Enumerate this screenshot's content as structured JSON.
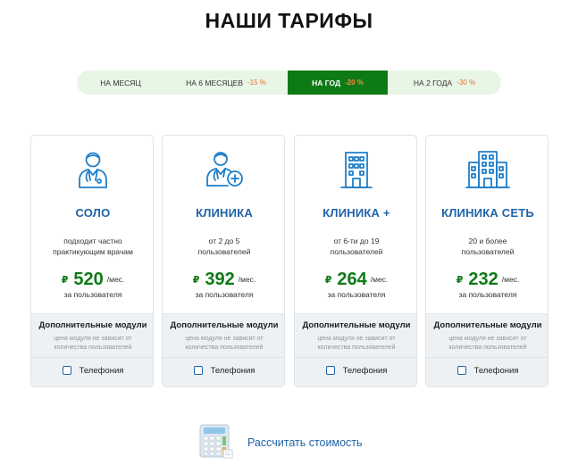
{
  "page": {
    "title": "НАШИ ТАРИФЫ"
  },
  "periods": [
    {
      "label": "НА МЕСЯЦ",
      "discount": "",
      "active": false
    },
    {
      "label": "НА 6 МЕСЯЦЕВ",
      "discount": "-15 %",
      "active": false
    },
    {
      "label": "НА ГОД",
      "discount": "-20 %",
      "active": true
    },
    {
      "label": "НА 2 ГОДА",
      "discount": "-30 %",
      "active": false
    }
  ],
  "plans": [
    {
      "icon": "doctor-icon",
      "name": "СОЛО",
      "desc_line1": "подходит частно",
      "desc_line2": "практикующим врачам",
      "currency": "₽",
      "price": "520",
      "unit": "/мес.",
      "per": "за пользователя",
      "modules_title": "Дополнительные модули",
      "modules_note_line1": "цена модуля не зависит от",
      "modules_note_line2": "количества пользователей",
      "option": "Телефония",
      "option_checked": false
    },
    {
      "icon": "doctor-plus-icon",
      "name": "КЛИНИКА",
      "desc_line1": "от 2 до 5",
      "desc_line2": "пользователей",
      "currency": "₽",
      "price": "392",
      "unit": "/мес.",
      "per": "за пользователя",
      "modules_title": "Дополнительные модули",
      "modules_note_line1": "цена модуля не зависит от",
      "modules_note_line2": "количества пользователей",
      "option": "Телефония",
      "option_checked": false
    },
    {
      "icon": "building-icon",
      "name": "КЛИНИКА +",
      "desc_line1": "от 6-ти до 19",
      "desc_line2": "пользователей",
      "currency": "₽",
      "price": "264",
      "unit": "/мес.",
      "per": "за пользователя",
      "modules_title": "Дополнительные модули",
      "modules_note_line1": "цена модуля не зависит от",
      "modules_note_line2": "количества пользователей",
      "option": "Телефония",
      "option_checked": false
    },
    {
      "icon": "hospital-network-icon",
      "name": "КЛИНИКА СЕТЬ",
      "desc_line1": "20 и более",
      "desc_line2": "пользователей",
      "currency": "₽",
      "price": "232",
      "unit": "/мес.",
      "per": "за пользователя",
      "modules_title": "Дополнительные модули",
      "modules_note_line1": "цена модуля не зависит от",
      "modules_note_line2": "количества пользователей",
      "option": "Телефония",
      "option_checked": false
    }
  ],
  "calculator": {
    "icon": "calculator-icon",
    "label": "Рассчитать стоимость"
  },
  "colors": {
    "accent_green": "#0e7a16",
    "accent_blue": "#1f63a8",
    "discount_orange": "#e8702a",
    "tab_bg": "#e8f6e6"
  }
}
